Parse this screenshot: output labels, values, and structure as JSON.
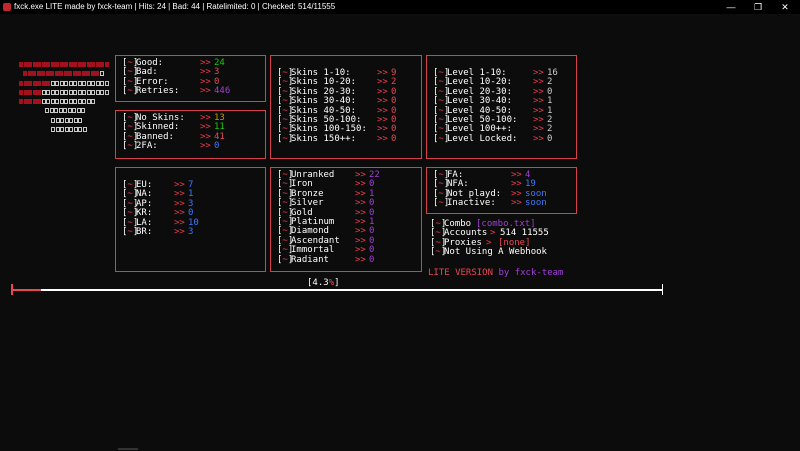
{
  "window": {
    "title": "fxck.exe LITE made by fxck-team | Hits: 24 | Bad: 44 | Ratelimited: 0 | Checked: 514/11555",
    "minimize": "—",
    "maximize": "❐",
    "close": "✕"
  },
  "stats_box": [
    {
      "label": "Good:",
      "value": "24",
      "color": "#16c60c"
    },
    {
      "label": "Bad:",
      "value": "3",
      "color": "#e74856"
    },
    {
      "label": "Error:",
      "value": "0",
      "color": "#e74856"
    },
    {
      "label": "Retries:",
      "value": "446",
      "color": "#a23edb"
    }
  ],
  "skins_status_box": [
    {
      "label": "No Skins:",
      "value": "13",
      "color": "#c19c00"
    },
    {
      "label": "Skinned:",
      "value": "11",
      "color": "#16c60c"
    },
    {
      "label": "Banned:",
      "value": "41",
      "color": "#e74856"
    },
    {
      "label": "2FA:",
      "value": "0",
      "color": "#3b78ff"
    }
  ],
  "skins_count_box": [
    {
      "label": "Skins 1-10:",
      "value": "9"
    },
    {
      "label": "Skins 10-20:",
      "value": "2"
    },
    {
      "label": "Skins 20-30:",
      "value": "0"
    },
    {
      "label": "Skins 30-40:",
      "value": "0"
    },
    {
      "label": "Skins 40-50:",
      "value": "0"
    },
    {
      "label": "Skins 50-100:",
      "value": "0"
    },
    {
      "label": "Skins 100-150:",
      "value": "0"
    },
    {
      "label": "Skins 150++:",
      "value": "0"
    }
  ],
  "level_box": [
    {
      "label": "Level 1-10:",
      "value": "16"
    },
    {
      "label": "Level 10-20:",
      "value": "2"
    },
    {
      "label": "Level 20-30:",
      "value": "0"
    },
    {
      "label": "Level 30-40:",
      "value": "1"
    },
    {
      "label": "Level 40-50:",
      "value": "1"
    },
    {
      "label": "Level 50-100:",
      "value": "2"
    },
    {
      "label": "Level 100++:",
      "value": "2"
    },
    {
      "label": "Level Locked:",
      "value": "0"
    }
  ],
  "region_box": [
    {
      "label": "EU:",
      "value": "7"
    },
    {
      "label": "NA:",
      "value": "1"
    },
    {
      "label": "AP:",
      "value": "3"
    },
    {
      "label": "KR:",
      "value": "0"
    },
    {
      "label": "LA:",
      "value": "10"
    },
    {
      "label": "BR:",
      "value": "3"
    }
  ],
  "rank_box": [
    {
      "label": "Unranked",
      "value": "22"
    },
    {
      "label": "Iron",
      "value": "0"
    },
    {
      "label": "Bronze",
      "value": "1"
    },
    {
      "label": "Silver",
      "value": "0"
    },
    {
      "label": "Gold",
      "value": "0"
    },
    {
      "label": "Platinum",
      "value": "1"
    },
    {
      "label": "Diamond",
      "value": "0"
    },
    {
      "label": "Ascendant",
      "value": "0"
    },
    {
      "label": "Immortal",
      "value": "0"
    },
    {
      "label": "Radiant",
      "value": "0"
    }
  ],
  "access_box": [
    {
      "label": "FA:",
      "value": "4",
      "color": "#a23edb"
    },
    {
      "label": "NFA:",
      "value": "19",
      "color": "#3b78ff"
    },
    {
      "label": "Not playd:",
      "value": "soon",
      "color": "#3b78ff"
    },
    {
      "label": "Inactive:",
      "value": "soon",
      "color": "#3b78ff"
    }
  ],
  "info": {
    "combo_label": "Combo",
    "combo_value": "[combo.txt]",
    "accounts_label": "Accounts",
    "accounts_value": "514 11555",
    "proxies_label": "Proxies",
    "proxies_value": "[none]",
    "webhook": "Not Using A Webhook"
  },
  "lite_text_1": "LITE VERSION",
  "lite_text_2": " by fxck-team",
  "bracket_symbol": "~",
  "arrow_symbol": ">>",
  "small_arrow": ">",
  "progress": {
    "fraction": 0.0445,
    "label_prefix": "[4.3",
    "label_highlight": "%",
    "label_suffix": "]"
  }
}
